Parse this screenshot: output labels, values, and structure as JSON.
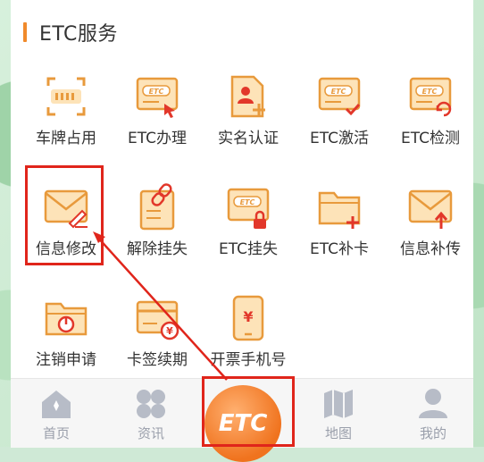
{
  "section": {
    "title": "ETC服务"
  },
  "services": [
    {
      "label": "车牌占用",
      "icon": "license-plate-scan-icon"
    },
    {
      "label": "ETC办理",
      "icon": "etc-card-apply-icon"
    },
    {
      "label": "实名认证",
      "icon": "user-document-verify-icon"
    },
    {
      "label": "ETC激活",
      "icon": "etc-card-activate-icon"
    },
    {
      "label": "ETC检测",
      "icon": "etc-card-check-icon"
    },
    {
      "label": "信息修改",
      "icon": "envelope-edit-icon"
    },
    {
      "label": "解除挂失",
      "icon": "document-unlink-icon"
    },
    {
      "label": "ETC挂失",
      "icon": "etc-card-lock-icon"
    },
    {
      "label": "ETC补卡",
      "icon": "folder-add-icon"
    },
    {
      "label": "信息补传",
      "icon": "envelope-upload-icon"
    },
    {
      "label": "注销申请",
      "icon": "folder-power-icon"
    },
    {
      "label": "卡签续期",
      "icon": "card-yuan-renew-icon"
    },
    {
      "label": "开票手机号",
      "icon": "phone-invoice-icon"
    }
  ],
  "tabbar": {
    "items": [
      {
        "label": "首页",
        "icon": "home-icon"
      },
      {
        "label": "资讯",
        "icon": "grid-clover-icon"
      },
      {
        "label": "地图",
        "icon": "map-icon"
      },
      {
        "label": "我的",
        "icon": "profile-icon"
      }
    ],
    "center": {
      "label": "ETC",
      "icon": "etc-logo-icon"
    }
  },
  "colors": {
    "accent": "#f08a2b",
    "icon_fill": "#fde3b8",
    "icon_stroke": "#e89a3c",
    "highlight": "#e0251b",
    "tab_inactive": "#9a9fab"
  }
}
